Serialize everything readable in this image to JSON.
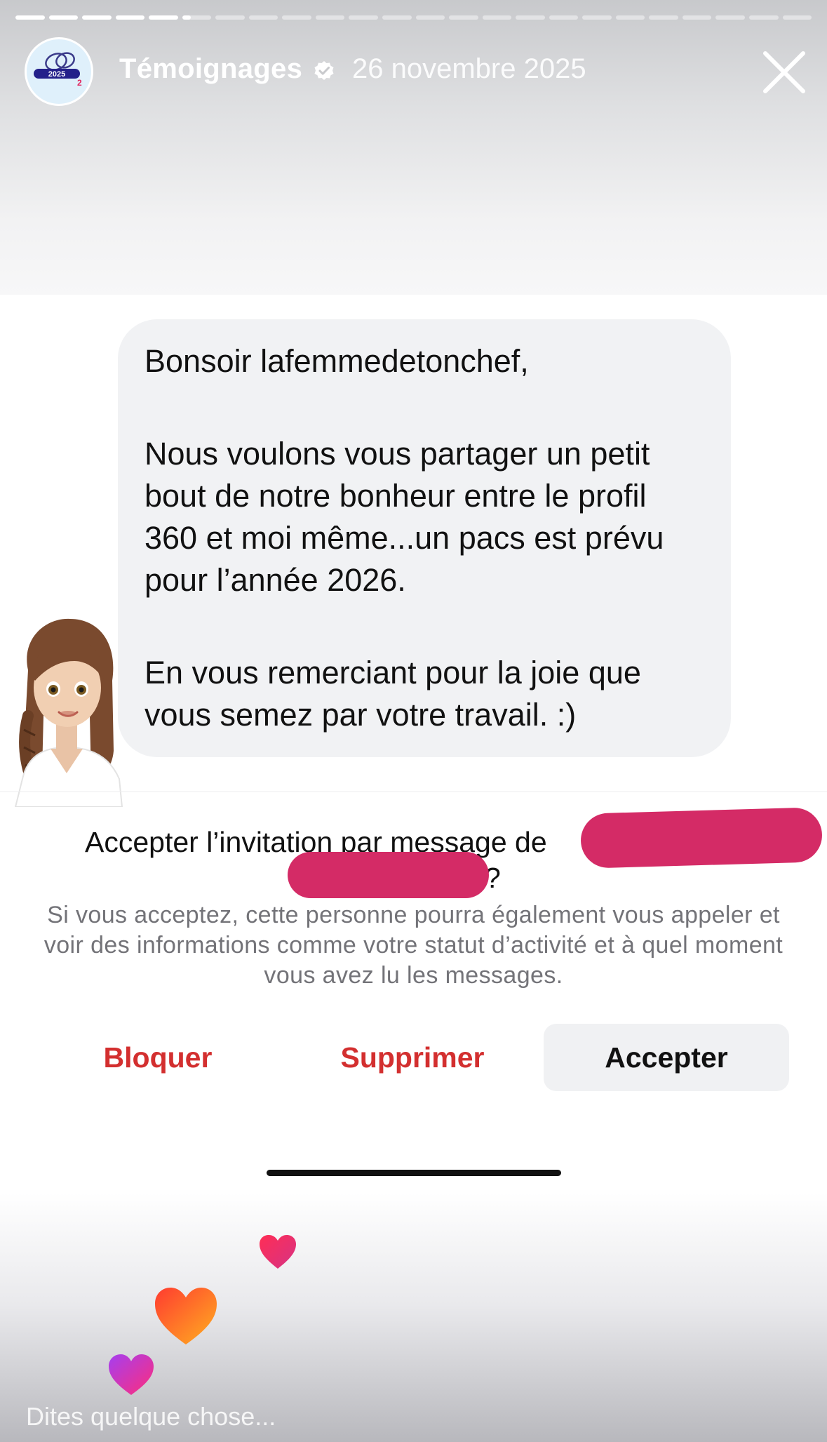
{
  "story": {
    "progress_segments": 24,
    "segments_viewed": 5,
    "current_segment_progress": 0.3
  },
  "header": {
    "account_name": "Témoignages",
    "avatar_label": "2025",
    "date": "26 novembre 2025",
    "verified_icon": "verified-badge-icon",
    "close_icon": "close-icon"
  },
  "message": {
    "greeting": "Bonsoir lafemmedetonchef,",
    "paragraph_1": "Nous voulons vous partager un petit bout de notre bonheur entre le profil 360 et moi même...un pacs est prévu pour l’année 2026.",
    "paragraph_2": "En vous remerciant pour la joie que vous semez par votre travail. :)"
  },
  "request": {
    "title": "Accepter l’invitation par message de",
    "question_mark": "?",
    "info": "Si vous acceptez, cette personne pourra également vous appeler et voir des informations comme votre statut d’activité et à quel moment vous avez lu les messages.",
    "buttons": {
      "block": "Bloquer",
      "delete": "Supprimer",
      "accept": "Accepter"
    }
  },
  "reply": {
    "placeholder": "Dites quelque chose..."
  },
  "colors": {
    "destructive": "#d32f2f",
    "redaction": "#d42b66",
    "bubble": "#f1f2f4"
  }
}
